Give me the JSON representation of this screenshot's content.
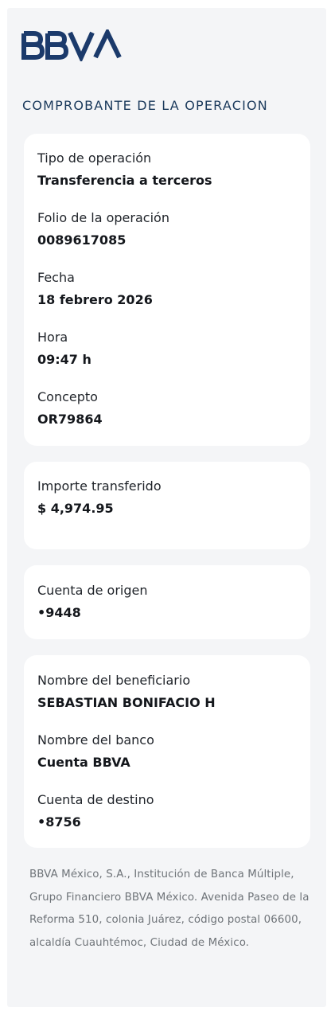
{
  "brand": {
    "logo_text": "BBVA",
    "color": "#1b3a6b"
  },
  "receipt": {
    "title": "COMPROBANTE  DE  LA OPERACION"
  },
  "operation": {
    "tipo_label": "Tipo de operación",
    "tipo_value": "Transferencia a terceros",
    "folio_label": "Folio de la operación",
    "folio_value": "0089617085",
    "fecha_label": "Fecha",
    "fecha_value": "18 febrero 2026",
    "hora_label": "Hora",
    "hora_value": "09:47 h",
    "concepto_label": "Concepto",
    "concepto_value": "OR79864"
  },
  "amount": {
    "label": "Importe transferido",
    "value": "$ 4,974.95"
  },
  "origin": {
    "label": "Cuenta de origen",
    "value": "•9448"
  },
  "beneficiary": {
    "name_label": "Nombre del beneficiario",
    "name_value": "SEBASTIAN BONIFACIO H",
    "bank_label": "Nombre del banco",
    "bank_value": "Cuenta BBVA",
    "dest_label": "Cuenta de destino",
    "dest_value": "•8756"
  },
  "legal": {
    "text": "BBVA México, S.A., Institución de Banca Múltiple, Grupo Financiero BBVA México. Avenida Paseo de la Reforma 510, colonia Juárez, código postal 06600, alcaldía Cuauhtémoc, Ciudad de México."
  }
}
